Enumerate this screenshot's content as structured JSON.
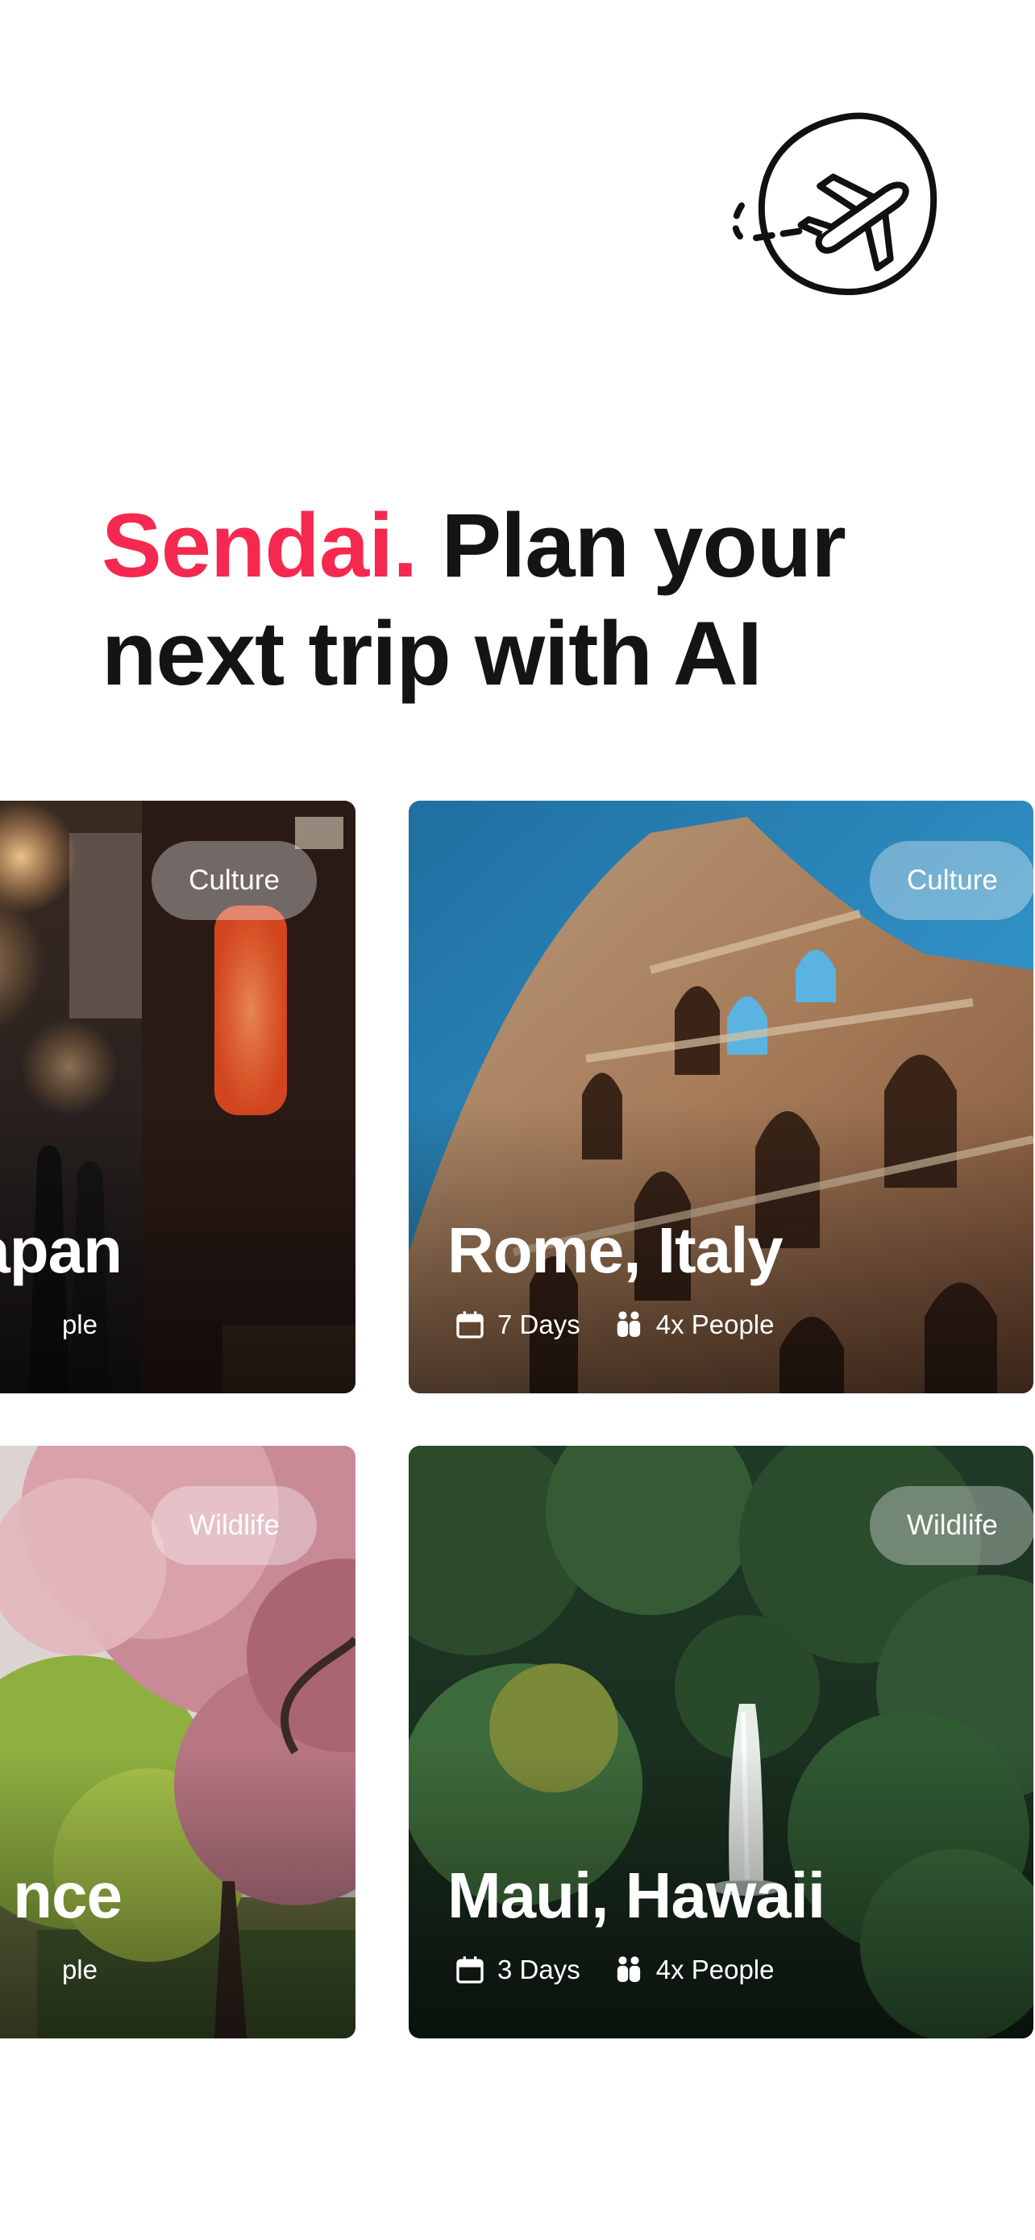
{
  "app": {
    "logo_icon": "airplane-circle-icon",
    "headline": {
      "brand": "Sendai.",
      "line1_rest": " Plan your",
      "line2": "next trip with AI"
    },
    "colors": {
      "brand": "#f5294f",
      "text": "#141414"
    }
  },
  "trips": [
    {
      "place": "Japan",
      "tag": "Culture",
      "days": "",
      "people": "ple"
    },
    {
      "place": "Rome, Italy",
      "tag": "Culture",
      "days": "7 Days",
      "people": "4x People"
    },
    {
      "place": "nce",
      "tag": "Wildlife",
      "days": "",
      "people": "ple"
    },
    {
      "place": "Maui, Hawaii",
      "tag": "Wildlife",
      "days": "3 Days",
      "people": "4x People"
    }
  ],
  "icons": {
    "calendar": "calendar-icon",
    "people": "people-icon"
  }
}
